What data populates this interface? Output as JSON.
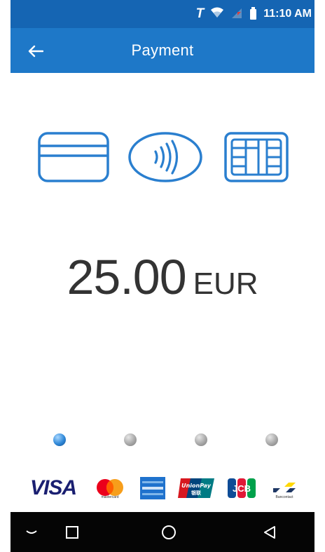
{
  "status_bar": {
    "carrier": "T",
    "time": "11:10 AM"
  },
  "app_bar": {
    "title": "Payment",
    "back_icon": "arrow-left-icon"
  },
  "payment_methods": [
    {
      "name": "magstripe-card-icon"
    },
    {
      "name": "contactless-icon"
    },
    {
      "name": "chip-card-icon"
    }
  ],
  "amount": {
    "value": "25.00",
    "currency": "EUR"
  },
  "progress": {
    "total": 4,
    "current": 1
  },
  "brands": {
    "visa": "VISA",
    "mastercard": "mastercard",
    "amex": "AMERICAN EXPRESS",
    "unionpay": "UnionPay",
    "unionpay_cn": "银联",
    "jcb": "JCB",
    "bancontact": "Bancontact"
  },
  "colors": {
    "status_bar": "#1565b3",
    "app_bar": "#1e78c8",
    "icon_blue": "#2a7fcf",
    "amount_text": "#333333",
    "nav_bar": "#050505"
  },
  "nav_bar": {
    "items": [
      "collapse-icon",
      "recents-icon",
      "home-icon",
      "back-icon"
    ]
  }
}
